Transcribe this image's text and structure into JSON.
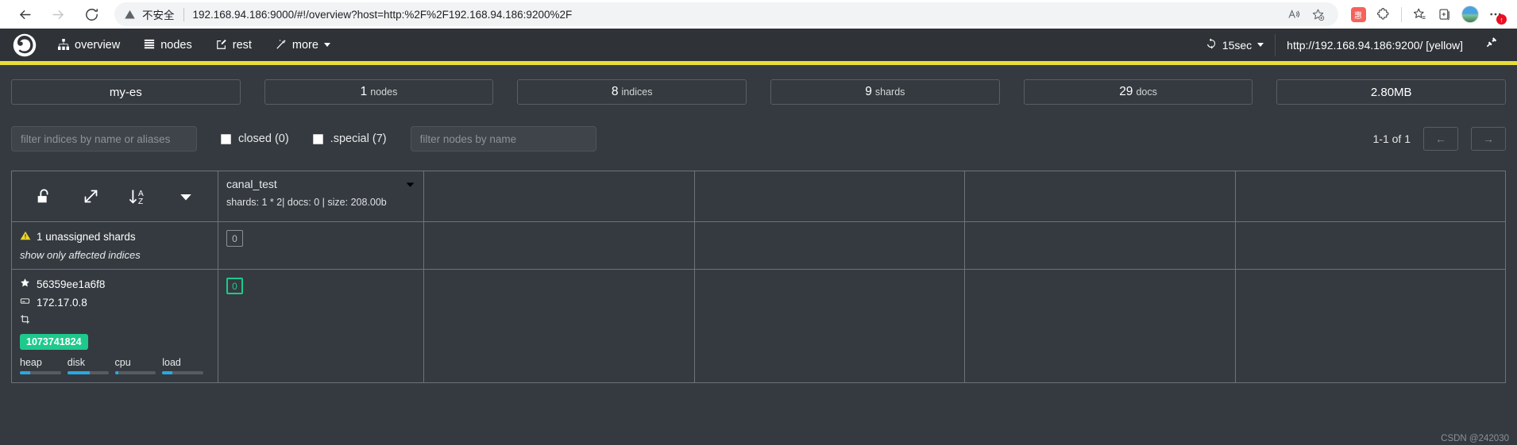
{
  "browser": {
    "back_icon": "back-arrow-icon",
    "forward_icon": "forward-arrow-icon",
    "reload_icon": "reload-icon",
    "security_warning": "不安全",
    "url": "192.168.94.186:9000/#!/overview?host=http:%2F%2F192.168.94.186:9200%2F",
    "url_host": "192.168.94.186:9000",
    "url_path": "/#!/overview?host=http:%2F%2F192.168.94.186:9200%2F",
    "read_aloud_icon": "read-aloud-icon",
    "add_favorite_icon": "add-favorite-icon",
    "extension_badge": "惠",
    "extensions_icon": "extensions-icon",
    "favorites_icon": "favorites-icon",
    "collections_icon": "collections-icon",
    "profile_icon": "profile-avatar",
    "settings_more_icon": "settings-and-more-icon",
    "settings_more_badge": "↑"
  },
  "navbar": {
    "logo_name": "cerebro-logo",
    "items": [
      {
        "label": "overview",
        "icon": "sitemap-icon"
      },
      {
        "label": "nodes",
        "icon": "list-icon"
      },
      {
        "label": "rest",
        "icon": "edit-square-icon"
      },
      {
        "label": "more",
        "icon": "magic-wand-icon",
        "has_caret": true
      }
    ],
    "refresh_interval": "15sec",
    "refresh_icon": "refresh-icon",
    "host_status": "http://192.168.94.186:9200/ [yellow]",
    "disconnect_icon": "plug-disconnect-icon"
  },
  "status_strip_color": "#e8dc3b",
  "stats": [
    {
      "value": "",
      "label": "my-es",
      "name": "cluster-name-card"
    },
    {
      "value": "1",
      "label": "nodes",
      "name": "nodes-card"
    },
    {
      "value": "8",
      "label": "indices",
      "name": "indices-card"
    },
    {
      "value": "9",
      "label": "shards",
      "name": "shards-card"
    },
    {
      "value": "29",
      "label": "docs",
      "name": "docs-card"
    },
    {
      "value": "",
      "label": "2.80MB",
      "name": "size-card"
    }
  ],
  "filters": {
    "indices_placeholder": "filter indices by name or aliases",
    "indices_value": "",
    "closed_label": "closed (0)",
    "closed_checked": false,
    "special_label": ".special (7)",
    "special_checked": false,
    "nodes_placeholder": "filter nodes by name",
    "nodes_value": "",
    "pager_label": "1-1 of 1",
    "prev_icon": "←",
    "next_icon": "→"
  },
  "grid": {
    "header_icons": [
      {
        "name": "unlock-icon",
        "glyph": "lock-open"
      },
      {
        "name": "expand-arrows-icon",
        "glyph": "expand"
      },
      {
        "name": "sort-az-icon",
        "glyph": "sort-az"
      },
      {
        "name": "filter-caret-icon",
        "glyph": "caret-down"
      }
    ],
    "index": {
      "name": "canal_test",
      "meta": "shards: 1 * 2| docs: 0 | size: 208.00b",
      "caret_icon": "index-menu-caret-icon"
    },
    "unassigned": {
      "warning_icon": "warning-triangle-icon",
      "title": "1 unassigned shards",
      "link": "show only affected indices",
      "shard_value": "0"
    },
    "node": {
      "star_icon": "master-star-icon",
      "name": "56359ee1a6f8",
      "host_icon": "server-icon",
      "host": "172.17.0.8",
      "extra_icon": "node-role-icon",
      "heap_bytes": "1073741824",
      "shard_value": "0",
      "metrics": [
        {
          "label": "heap",
          "percent": 25
        },
        {
          "label": "disk",
          "percent": 55
        },
        {
          "label": "cpu",
          "percent": 8
        },
        {
          "label": "load",
          "percent": 25
        }
      ]
    }
  },
  "watermark": "CSDN @242030",
  "colors": {
    "accent_green": "#1ec98c",
    "accent_blue": "#29a8e0",
    "status_yellow": "#e8dc3b",
    "warning_yellow": "#ecd527",
    "app_bg": "#343a40",
    "nav_bg": "#2f3337"
  }
}
